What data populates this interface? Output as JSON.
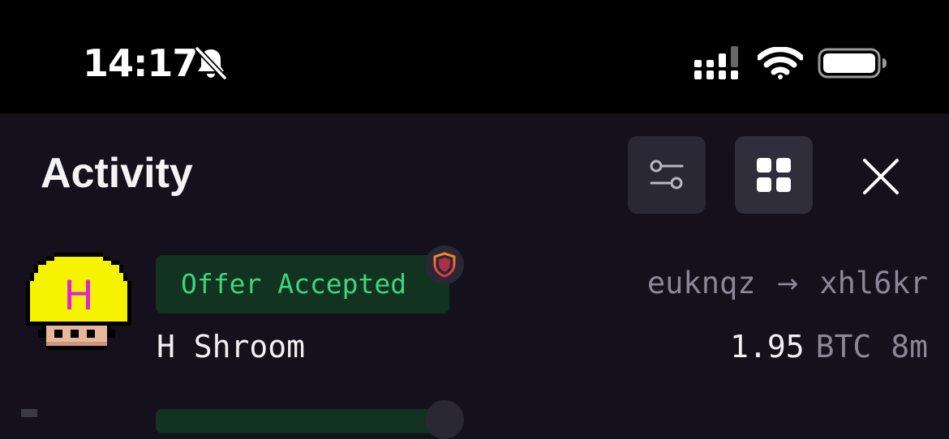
{
  "status_bar": {
    "time": "14:17",
    "icons": [
      "bell-slash-icon",
      "cellular-signal-icon",
      "wifi-icon",
      "battery-icon"
    ]
  },
  "header": {
    "title": "Activity",
    "buttons": [
      "sliders-filter-icon",
      "grid-view-icon",
      "close-icon"
    ]
  },
  "activity": {
    "items": [
      {
        "status": "Offer Accepted",
        "name": "H Shroom",
        "from": "euknqz",
        "to": "xhl6kr",
        "arrow": "→",
        "price": "1.95",
        "currency": "BTC",
        "time": "8m",
        "avatar_letter": "H",
        "status_color": "#3fd47e"
      }
    ]
  },
  "colors": {
    "background": "#14111d",
    "status_bar": "#000000",
    "button_bg": "#2a2835",
    "pill_bg": "#11331f",
    "muted_text": "#8a8797",
    "avatar_yellow": "#f6f300",
    "avatar_letter": "#e020d8"
  }
}
